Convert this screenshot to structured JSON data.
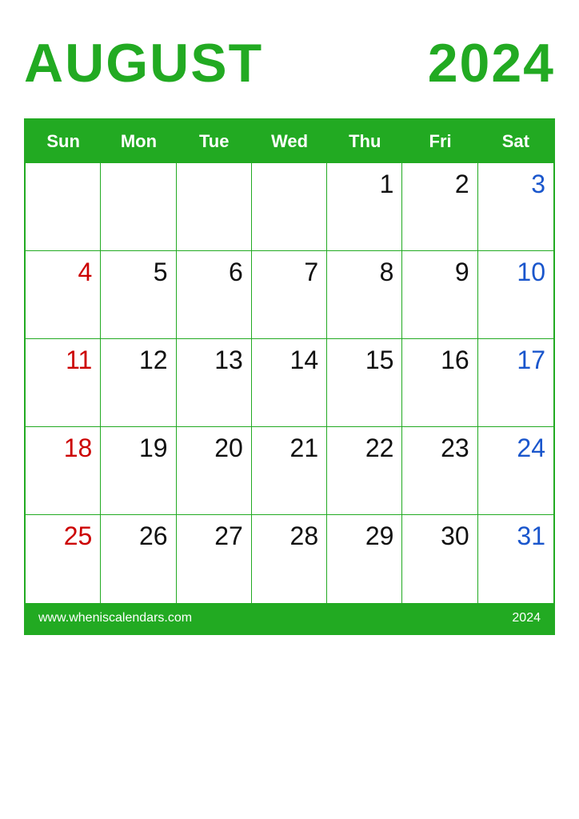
{
  "header": {
    "month": "AUGUST",
    "year": "2024"
  },
  "days_of_week": [
    "Sun",
    "Mon",
    "Tue",
    "Wed",
    "Thu",
    "Fri",
    "Sat"
  ],
  "weeks": [
    [
      {
        "day": "",
        "type": "empty"
      },
      {
        "day": "",
        "type": "empty"
      },
      {
        "day": "",
        "type": "empty"
      },
      {
        "day": "",
        "type": "empty"
      },
      {
        "day": "1",
        "type": "normal"
      },
      {
        "day": "2",
        "type": "normal"
      },
      {
        "day": "3",
        "type": "saturday"
      }
    ],
    [
      {
        "day": "4",
        "type": "sunday"
      },
      {
        "day": "5",
        "type": "normal"
      },
      {
        "day": "6",
        "type": "normal"
      },
      {
        "day": "7",
        "type": "normal"
      },
      {
        "day": "8",
        "type": "normal"
      },
      {
        "day": "9",
        "type": "normal"
      },
      {
        "day": "10",
        "type": "saturday"
      }
    ],
    [
      {
        "day": "11",
        "type": "sunday"
      },
      {
        "day": "12",
        "type": "normal"
      },
      {
        "day": "13",
        "type": "normal"
      },
      {
        "day": "14",
        "type": "normal"
      },
      {
        "day": "15",
        "type": "normal"
      },
      {
        "day": "16",
        "type": "normal"
      },
      {
        "day": "17",
        "type": "saturday"
      }
    ],
    [
      {
        "day": "18",
        "type": "sunday"
      },
      {
        "day": "19",
        "type": "normal"
      },
      {
        "day": "20",
        "type": "normal"
      },
      {
        "day": "21",
        "type": "normal"
      },
      {
        "day": "22",
        "type": "normal"
      },
      {
        "day": "23",
        "type": "normal"
      },
      {
        "day": "24",
        "type": "saturday"
      }
    ],
    [
      {
        "day": "25",
        "type": "sunday"
      },
      {
        "day": "26",
        "type": "normal"
      },
      {
        "day": "27",
        "type": "normal"
      },
      {
        "day": "28",
        "type": "normal"
      },
      {
        "day": "29",
        "type": "normal"
      },
      {
        "day": "30",
        "type": "normal"
      },
      {
        "day": "31",
        "type": "saturday"
      }
    ]
  ],
  "footer": {
    "url": "www.wheniscalendars.com",
    "year": "2024"
  },
  "colors": {
    "green": "#22aa22",
    "sunday_red": "#cc0000",
    "saturday_blue": "#1a56cc",
    "normal_black": "#111111"
  }
}
